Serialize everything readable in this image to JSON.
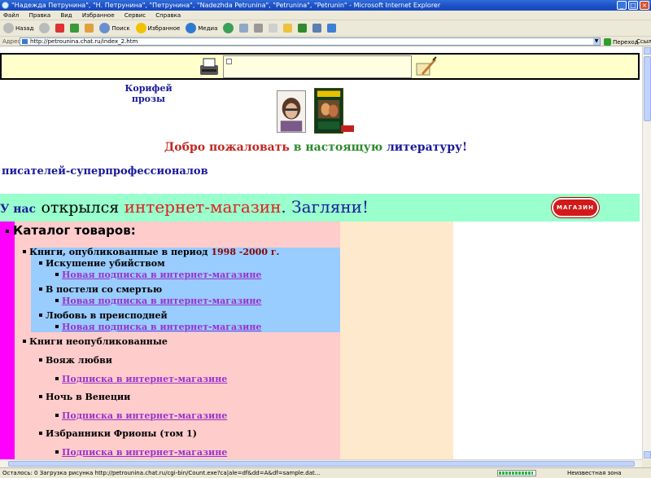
{
  "window": {
    "title": "\"Надежда Петрунина\", \"Н. Петрунина\", \"Петрунина\", \"Nadezhda Petrunina\", \"Petrunina\", \"Petrunin\" - Microsoft Internet Explorer"
  },
  "menu": [
    "Файл",
    "Правка",
    "Вид",
    "Избранное",
    "Сервис",
    "Справка"
  ],
  "toolbar": {
    "back": "Назад",
    "search": "Поиск",
    "favorites": "Избранное",
    "media": "Медиа"
  },
  "address": {
    "label": "Адрес",
    "url": "http://petrounina.chat.ru/index_2.htm",
    "go": "Переход",
    "links": "Ссылки"
  },
  "page": {
    "koryfei": [
      "Корифей",
      "прозы"
    ],
    "welcome": {
      "part1": "Добро пожаловать",
      "part2": "в настоящую",
      "part3": "литературу!"
    },
    "pisateli": "писателей-суперпрофессионалов",
    "shop": {
      "part1": "У нас",
      "part2": "открылся",
      "part3": "интернет-магазин",
      "part4": ".",
      "part5": "Загляни!",
      "button": "МАГАЗИН"
    },
    "catalog": {
      "title": "Каталог товаров:",
      "group1": {
        "label": "Книги, опубликованные в период",
        "period": "1998 -2000 г.",
        "books": [
          {
            "title": "Искушение убийством",
            "link": "Новая подписка в интернет-магазине"
          },
          {
            "title": "В постели со смертью",
            "link": "Новая подписка в интернет-магазине"
          },
          {
            "title": "Любовь в преисподней",
            "link": "Новая подписка в интернет-магазине"
          }
        ]
      },
      "group2": {
        "label": "Книги неопубликованные",
        "books": [
          {
            "title": "Вояж любви",
            "link": "Подписка в интернет-магазине"
          },
          {
            "title": "Ночь в Венеции",
            "link": "Подписка в интернет-магазине"
          },
          {
            "title": "Избранники Фрионы (том 1)",
            "link": "Подписка в интернет-магазине"
          }
        ]
      }
    }
  },
  "status": {
    "text": "Осталось: 0 Загрузка рисунка http://petrounina.chat.ru/cgi-bin/Count.exe?ca|ale=df&dd=A&df=sample.dat...",
    "progress": 0.95,
    "zone": "Неизвестная зона"
  }
}
